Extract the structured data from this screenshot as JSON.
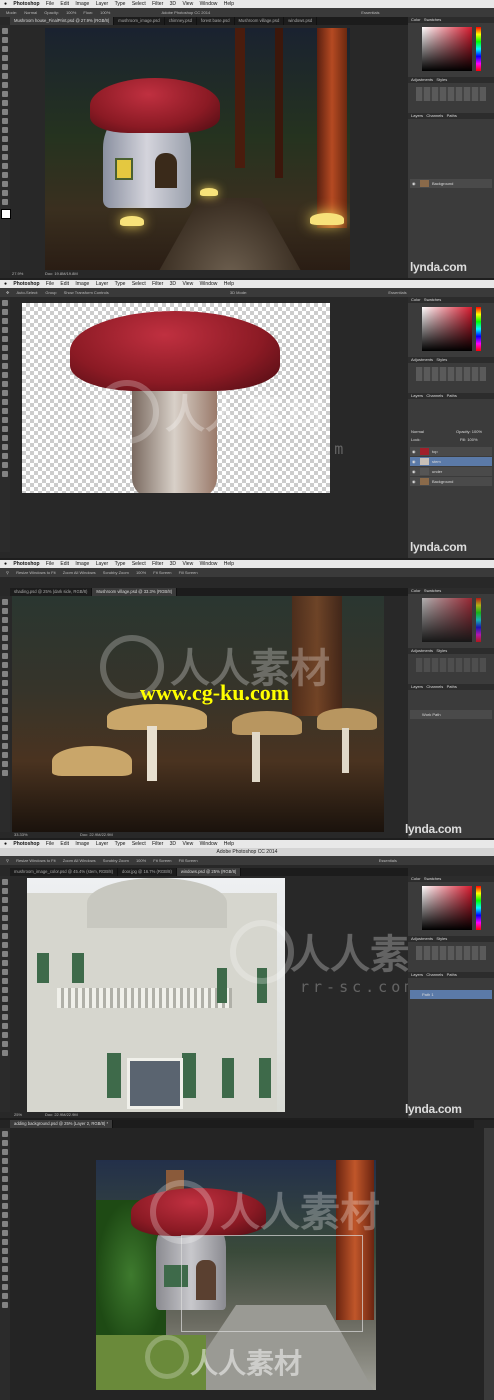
{
  "app_name": "Photoshop",
  "window_title": "Adobe Photoshop CC 2014",
  "menu": [
    "File",
    "Edit",
    "Image",
    "Layer",
    "Type",
    "Select",
    "Filter",
    "3D",
    "View",
    "Window",
    "Help"
  ],
  "workspace": "Essentials",
  "brand": "lynda.com",
  "watermark": {
    "cn": "人人素材",
    "url": "rr-sc.com",
    "ku": "www.cg-ku.com"
  },
  "colors": {
    "accent_red": "#d51a2e",
    "mushroom_red": "#8b1a24",
    "selection_blue": "#5b7aa8"
  },
  "panel1": {
    "options": [
      "Mode:",
      "Normal",
      "Opacity:",
      "100%",
      "Flow:",
      "100%"
    ],
    "tabs": [
      "Mushroom house_FinalPrint.psd @ 27.9% (RGB/8)",
      "mushroom_image.psd",
      "chimney.psd",
      "forest base.psd",
      "Mushroom village.psd",
      "windows.psd"
    ],
    "zoom": "27.9%",
    "doc": "Doc: 19.8M/19.8M",
    "panels": [
      "Color",
      "Swatches",
      "Adjustments",
      "Styles",
      "Layers",
      "Channels",
      "Paths"
    ],
    "layers": [
      "Background"
    ]
  },
  "panel2": {
    "options": [
      "Auto-Select:",
      "Group",
      "Show Transform Controls",
      "3D Mode:"
    ],
    "panels": [
      "Color",
      "Swatches",
      "Adjustments",
      "Styles",
      "Layers",
      "Channels",
      "Paths"
    ],
    "blend": "Normal",
    "opacity": "Opacity: 100%",
    "lock": "Lock:",
    "fill": "Fill: 100%",
    "layers": [
      "top",
      "stem",
      "under",
      "Background"
    ]
  },
  "panel3": {
    "options": [
      "Resize Windows to Fit",
      "Zoom All Windows",
      "Scrubby Zoom",
      "100%",
      "Fit Screen",
      "Fill Screen"
    ],
    "tabs": [
      "shading.psd @ 25% (dark side, RGB/8)",
      "Mushroom village.psd @ 33.3% (RGB/8)"
    ],
    "zoom": "33.33%",
    "doc": "Doc: 22.9M/22.9M",
    "panels": [
      "Color",
      "Swatches",
      "Adjustments",
      "Styles",
      "Layers",
      "Channels",
      "Paths"
    ],
    "layers": [
      "Work Path"
    ]
  },
  "panel4": {
    "options": [
      "Resize Windows to Fit",
      "Zoom All Windows",
      "Scrubby Zoom",
      "100%",
      "Fit Screen",
      "Fill Screen"
    ],
    "tabs": [
      "mushroom_image_color.psd @ 45.4% (stem, RGB/8)",
      "door.jpg @ 16.7% (RGB/8)",
      "windows.psd @ 25% (RGB/8)"
    ],
    "zoom": "25%",
    "doc": "Doc: 22.9M/22.9M",
    "panels": [
      "Color",
      "Swatches",
      "Adjustments",
      "Styles",
      "Layers",
      "Channels",
      "Paths"
    ],
    "layers": [
      "Path 1"
    ]
  },
  "panel5": {
    "tabs": [
      "adding background.psd @ 25% (Layer 2, RGB/8) *"
    ]
  }
}
